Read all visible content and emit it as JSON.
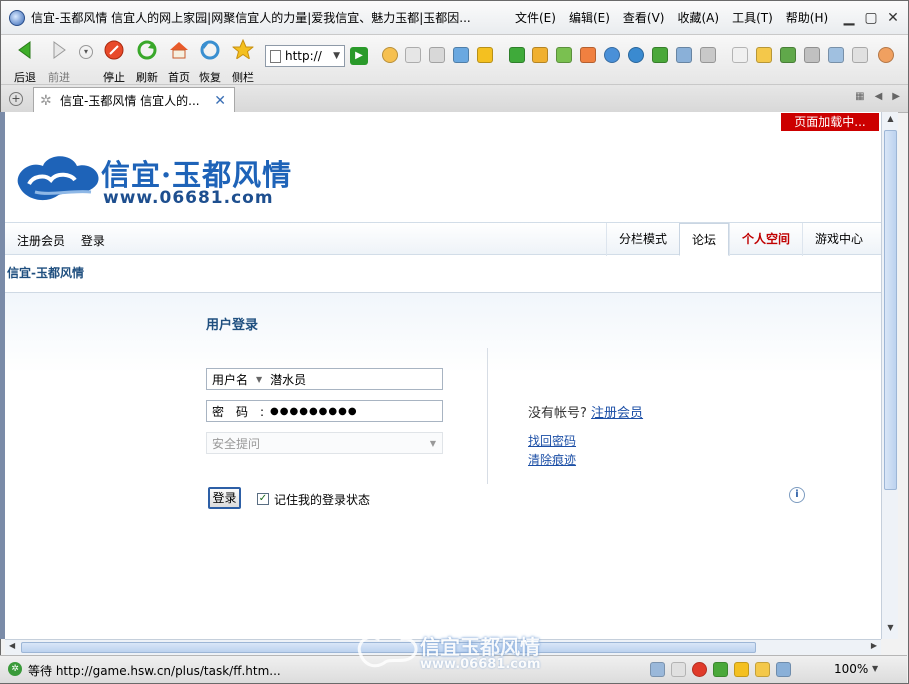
{
  "window": {
    "title": "信宜-玉都风情 信宜人的网上家园|网聚信宜人的力量|爱我信宜、魅力玉都|玉都因...",
    "menu": [
      "文件(E)",
      "编辑(E)",
      "查看(V)",
      "收藏(A)",
      "工具(T)",
      "帮助(H)"
    ]
  },
  "toolbar": {
    "back": "后退",
    "forward": "前进",
    "stop": "停止",
    "refresh": "刷新",
    "home": "首页",
    "restore": "恢复",
    "sidebar": "侧栏",
    "address_value": "http://"
  },
  "tabs": [
    {
      "title": "信宜-玉都风情 信宜人的..."
    }
  ],
  "page": {
    "loading_badge": "页面加载中...",
    "logo": {
      "text": "信宜·玉都风情",
      "url": "www.06681.com"
    },
    "nav_left": [
      "注册会员",
      "登录"
    ],
    "nav_right": [
      "分栏模式",
      "论坛",
      "个人空间",
      "游戏中心"
    ],
    "breadcrumb": "信宜-玉都风情",
    "login": {
      "title": "用户登录",
      "username_label": "用户名",
      "username_value": "潜水员",
      "password_label": "密　码　:",
      "password_value": "●●●●●●●●●",
      "security_label": "安全提问",
      "no_account_text": "没有帐号?",
      "register_link": "注册会员",
      "forgot_link": "找回密码",
      "clear_link": "清除痕迹",
      "submit": "登录",
      "remember_label": "记住我的登录状态"
    }
  },
  "status": {
    "text": "等待 http://game.hsw.cn/plus/task/ff.htm...",
    "zoom": "100%"
  },
  "watermark": {
    "text": "信宜玉都风情",
    "url": "www.06681.com"
  },
  "colors": {
    "brand_blue": "#1e63b8",
    "alert_red": "#cc0000",
    "link_blue": "#1c4fa6"
  }
}
